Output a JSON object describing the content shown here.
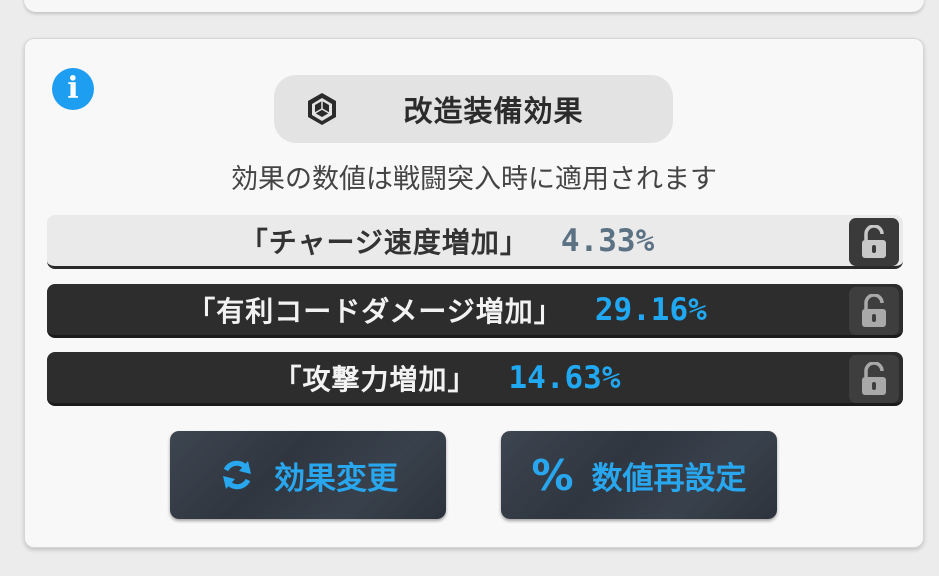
{
  "panel": {
    "title": "改造装備効果",
    "subtitle": "効果の数値は戦闘突入時に適用されます",
    "info_icon": "i"
  },
  "effects": [
    {
      "name": "「チャージ速度増加」",
      "value": "4.33%",
      "locked": false
    },
    {
      "name": "「有利コードダメージ増加」",
      "value": "29.16%",
      "locked": false
    },
    {
      "name": "「攻撃力増加」",
      "value": "14.63%",
      "locked": false
    }
  ],
  "buttons": {
    "change_effect": "効果変更",
    "reset_values": "数値再設定",
    "reset_values_icon": "%"
  },
  "colors": {
    "accent": "#20a8f2",
    "value_gray": "#5b7184",
    "row_dark": "#2d2d2d",
    "row_light": "#eaeaea"
  }
}
